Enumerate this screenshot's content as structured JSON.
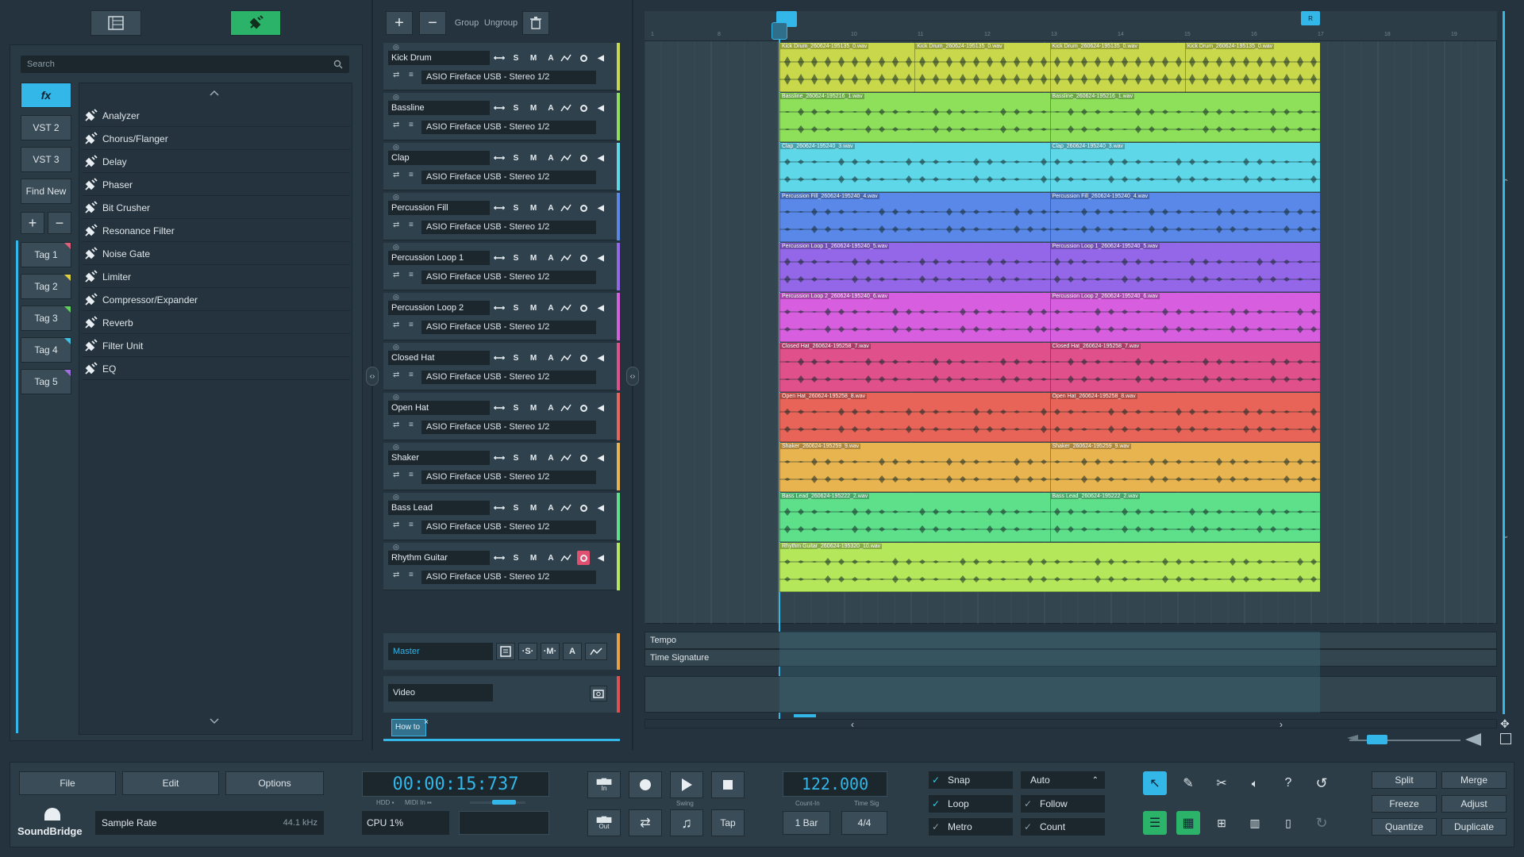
{
  "browser": {
    "top_buttons": [
      "list-icon",
      "plugin-icon"
    ],
    "search_placeholder": "Search",
    "categories": [
      {
        "label": "fx",
        "active": true
      },
      {
        "label": "VST 2"
      },
      {
        "label": "VST 3"
      },
      {
        "label": "Find New"
      }
    ],
    "tags": [
      {
        "label": "Tag 1",
        "color": "#e0607a"
      },
      {
        "label": "Tag 2",
        "color": "#e0d040"
      },
      {
        "label": "Tag 3",
        "color": "#60d060"
      },
      {
        "label": "Tag 4",
        "color": "#40c0e0"
      },
      {
        "label": "Tag 5",
        "color": "#a070e0"
      }
    ],
    "effects": [
      "Analyzer",
      "Chorus/Flanger",
      "Delay",
      "Phaser",
      "Bit Crusher",
      "Resonance Filter",
      "Noise Gate",
      "Limiter",
      "Compressor/Expander",
      "Reverb",
      "Filter Unit",
      "EQ"
    ]
  },
  "toolbar": {
    "group": "Group",
    "ungroup": "Ungroup"
  },
  "tracks": [
    {
      "name": "Kick Drum",
      "output": "ASIO Fireface USB - Stereo 1/2",
      "color": "#c8d84a",
      "clips": [
        "Kick Drum_260624-195135_0.wav",
        "Kick Drum_260624-195135_0.wav",
        "Kick Drum_260624-195135_0.wav",
        "Kick Drum_260624-195135_0.wav"
      ]
    },
    {
      "name": "Bassline",
      "output": "ASIO Fireface USB - Stereo 1/2",
      "color": "#8ee05a",
      "clips": [
        "Bassline_260624-195216_1.wav",
        "Bassline_260624-195216_1.wav"
      ]
    },
    {
      "name": "Clap",
      "output": "ASIO Fireface USB - Stereo 1/2",
      "color": "#5ed8e8",
      "clips": [
        "Clap_260624-195240_3.wav",
        "Clap_260624-195240_3.wav"
      ]
    },
    {
      "name": "Percussion Fill",
      "output": "ASIO Fireface USB - Stereo 1/2",
      "color": "#5a88e8",
      "clips": [
        "Percussion Fill_260624-195240_4.wav",
        "Percussion Fill_260624-195240_4.wav"
      ]
    },
    {
      "name": "Percussion Loop 1",
      "output": "ASIO Fireface USB - Stereo 1/2",
      "color": "#9466e8",
      "clips": [
        "Percussion Loop 1_260624-195240_5.wav",
        "Percussion Loop 1_260624-195240_5.wav"
      ]
    },
    {
      "name": "Percussion Loop 2",
      "output": "ASIO Fireface USB - Stereo 1/2",
      "color": "#d85ee0",
      "clips": [
        "Percussion Loop 2_260624-195240_6.wav",
        "Percussion Loop 2_260624-195240_6.wav"
      ]
    },
    {
      "name": "Closed Hat",
      "output": "ASIO Fireface USB - Stereo 1/2",
      "color": "#e0508a",
      "clips": [
        "Closed Hat_260624-195258_7.wav",
        "Closed Hat_260624-195258_7.wav"
      ]
    },
    {
      "name": "Open Hat",
      "output": "ASIO Fireface USB - Stereo 1/2",
      "color": "#e86458",
      "clips": [
        "Open Hat_260624-195258_8.wav",
        "Open Hat_260624-195258_8.wav"
      ]
    },
    {
      "name": "Shaker",
      "output": "ASIO Fireface USB - Stereo 1/2",
      "color": "#e8b450",
      "clips": [
        "Shaker_260624-195259_9.wav",
        "Shaker_260624-195259_9.wav"
      ]
    },
    {
      "name": "Bass Lead",
      "output": "ASIO Fireface USB - Stereo 1/2",
      "color": "#5ee08a",
      "clips": [
        "Bass Lead_260624-195222_2.wav",
        "Bass Lead_260624-195222_2.wav"
      ]
    },
    {
      "name": "Rhythm Guitar",
      "output": "ASIO Fireface USB - Stereo 1/2",
      "color": "#b4e85a",
      "clips": [
        "Rhythm Guitar_260624-195320_10.wav"
      ]
    }
  ],
  "master": {
    "name": "Master"
  },
  "video": {
    "name": "Video"
  },
  "howto": "How to",
  "automation": {
    "tempo": "Tempo",
    "timesig": "Time Signature"
  },
  "ruler": {
    "markers": [
      "1",
      "8",
      "9",
      "10",
      "11",
      "12",
      "13",
      "14",
      "15",
      "16",
      "17",
      "18",
      "19"
    ],
    "loop_end_label": "R"
  },
  "bottom": {
    "menu": [
      "File",
      "Edit",
      "Options"
    ],
    "logo": "SoundBridge",
    "sample_rate_label": "Sample Rate",
    "sample_rate_value": "44.1 kHz",
    "time": "00:00:15:737",
    "hdd": "HDD",
    "midi_in": "MIDI In",
    "cpu": "CPU 1%",
    "in_label": "In",
    "out_label": "Out",
    "swing": "Swing",
    "tap": "Tap",
    "tempo": "122.000",
    "count_in_label": "Count-In",
    "time_sig_label": "Time Sig",
    "count_in": "1 Bar",
    "time_sig": "4/4",
    "snap": "Snap",
    "auto": "Auto",
    "loop": "Loop",
    "follow": "Follow",
    "metro": "Metro",
    "count": "Count",
    "right_buttons": [
      "Split",
      "Merge",
      "Freeze",
      "Adjust",
      "Quantize",
      "Duplicate"
    ]
  }
}
